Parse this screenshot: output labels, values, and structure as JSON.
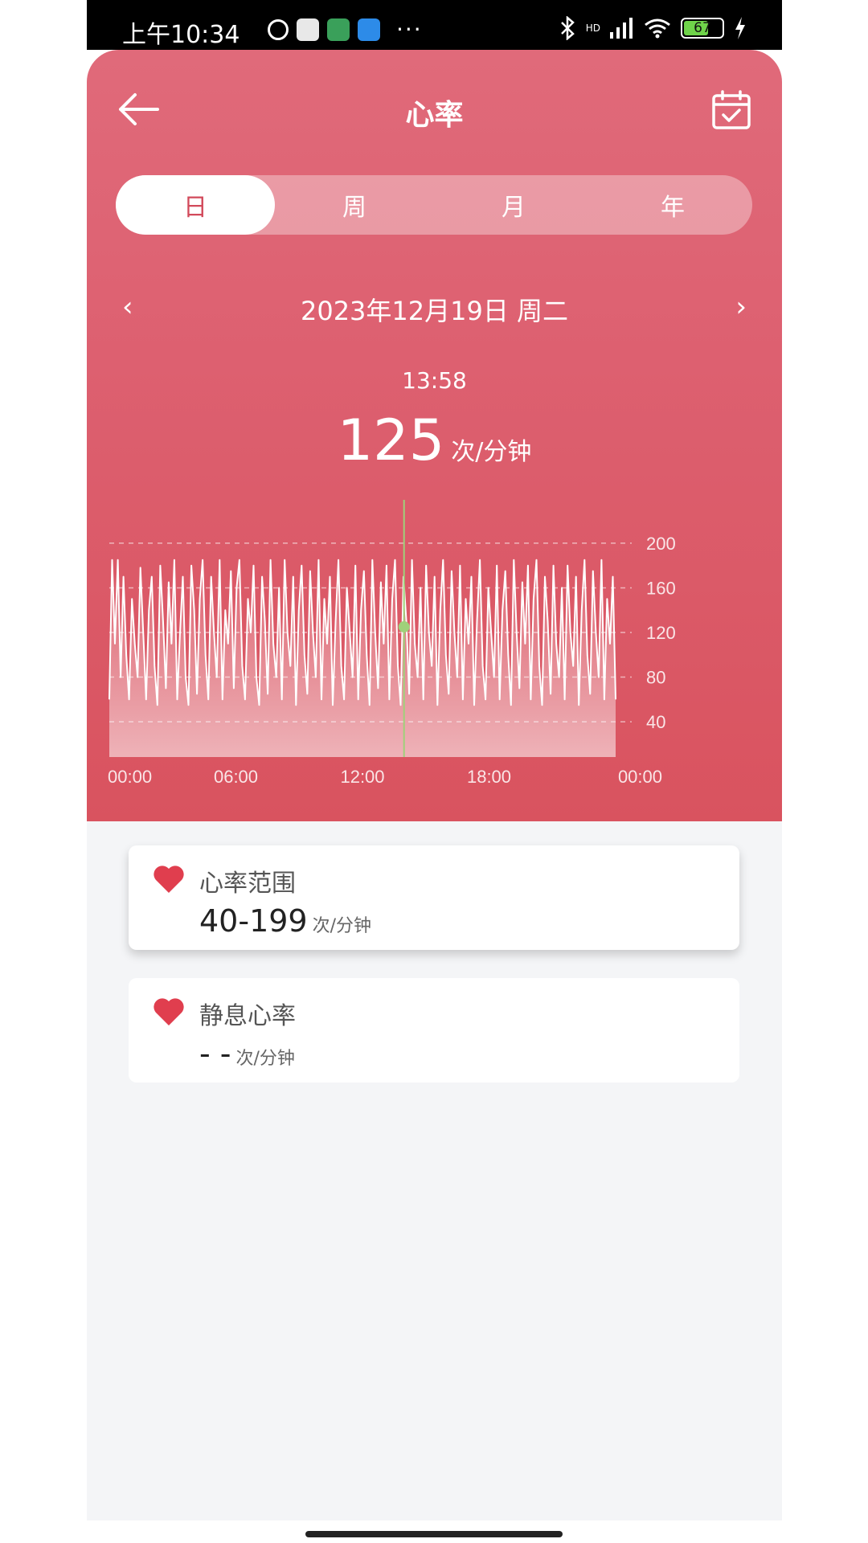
{
  "status": {
    "time": "上午10:34",
    "dots": "···",
    "battery": "67",
    "network": "HD"
  },
  "nav": {
    "title": "心率",
    "back_icon": "arrow-left-icon",
    "calendar_icon": "calendar-check-icon"
  },
  "tabs": [
    {
      "label": "日",
      "active": true
    },
    {
      "label": "周",
      "active": false
    },
    {
      "label": "月",
      "active": false
    },
    {
      "label": "年",
      "active": false
    }
  ],
  "date": {
    "text": "2023年12月19日 周二",
    "prev": "‹",
    "next": "›"
  },
  "selected": {
    "time": "13:58",
    "value": "125",
    "unit": "次/分钟"
  },
  "chart_data": {
    "type": "line",
    "title": "",
    "xlabel": "",
    "ylabel": "",
    "x_ticks": [
      "00:00",
      "06:00",
      "12:00",
      "18:00",
      "00:00"
    ],
    "y_ticks": [
      200,
      160,
      120,
      80,
      40
    ],
    "ylim": [
      30,
      210
    ],
    "xlim_hours": [
      0,
      24
    ],
    "grid": "horizontal-dashed",
    "marker": {
      "time_hours": 13.97,
      "value": 125
    },
    "series": [
      {
        "values": [
          60,
          185,
          110,
          185,
          80,
          170,
          100,
          60,
          150,
          110,
          80,
          178,
          120,
          60,
          140,
          170,
          90,
          55,
          180,
          130,
          70,
          165,
          110,
          185,
          60,
          120,
          170,
          80,
          55,
          180,
          140,
          65,
          150,
          185,
          100,
          60,
          170,
          120,
          80,
          185,
          60,
          140,
          110,
          175,
          70,
          160,
          185,
          90,
          60,
          150,
          120,
          180,
          80,
          55,
          170,
          130,
          65,
          185,
          110,
          80,
          160,
          60,
          185,
          120,
          90,
          170,
          55,
          140,
          180,
          100,
          65,
          175,
          120,
          80,
          185,
          60,
          150,
          110,
          170,
          55,
          130,
          185,
          90,
          60,
          160,
          120,
          80,
          180,
          60,
          140,
          175,
          100,
          55,
          185,
          120,
          70,
          165,
          110,
          180,
          60,
          150,
          185,
          90,
          55,
          170,
          130,
          65,
          185,
          110,
          80,
          160,
          60,
          180,
          120,
          90,
          170,
          55,
          140,
          185,
          100,
          65,
          175,
          120,
          80,
          180,
          60,
          150,
          110,
          170,
          55,
          130,
          185,
          90,
          60,
          160,
          120,
          80,
          180,
          60,
          140,
          175,
          100,
          55,
          185,
          120,
          70,
          165,
          110,
          180,
          60,
          150,
          185,
          90,
          55,
          170,
          130,
          65,
          180,
          110,
          80,
          160,
          60,
          180,
          120,
          90,
          170,
          55,
          140,
          185,
          100,
          65,
          175,
          120,
          80,
          185,
          60,
          150,
          110,
          170,
          60
        ]
      }
    ]
  },
  "cards": [
    {
      "title": "心率范围",
      "value": "40-199",
      "unit": "次/分钟",
      "icon": "heart-icon"
    },
    {
      "title": "静息心率",
      "value": "- -",
      "unit": "次/分钟",
      "icon": "heart-icon"
    }
  ],
  "colors": {
    "header_top": "#e06a7a",
    "header_bottom": "#d9535f",
    "accent": "#d24a5b",
    "heart": "#e03e4e",
    "marker_line": "#9fd17a"
  }
}
